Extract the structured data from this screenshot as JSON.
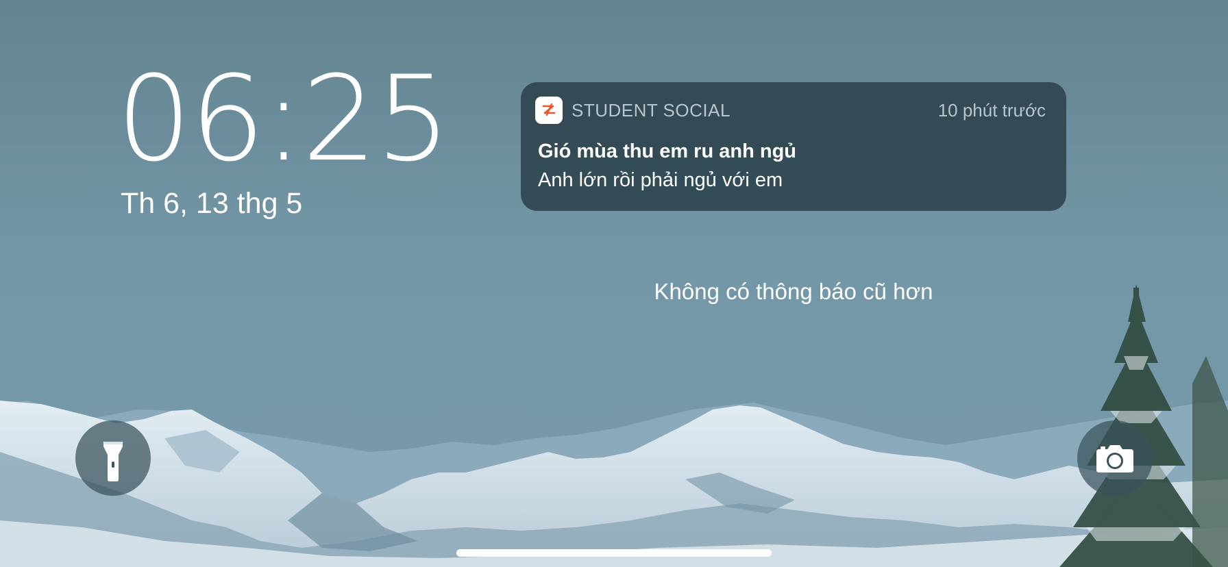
{
  "lock_screen": {
    "time": "06:25",
    "date": "Th 6, 13 thg 5",
    "no_older_notifications": "Không có thông báo cũ hơn"
  },
  "notification": {
    "app_name": "STUDENT SOCIAL",
    "time_ago": "10 phút trước",
    "title": "Gió mùa thu em ru anh ngủ",
    "body": "Anh lớn rồi phải ngủ với em",
    "app_icon": "student-social-logo",
    "accent_color": "#e8562a"
  },
  "controls": {
    "flashlight_icon": "flashlight-icon",
    "camera_icon": "camera-icon"
  },
  "colors": {
    "notification_bg": "#2c424c",
    "secondary_text": "#b9c6cc"
  }
}
